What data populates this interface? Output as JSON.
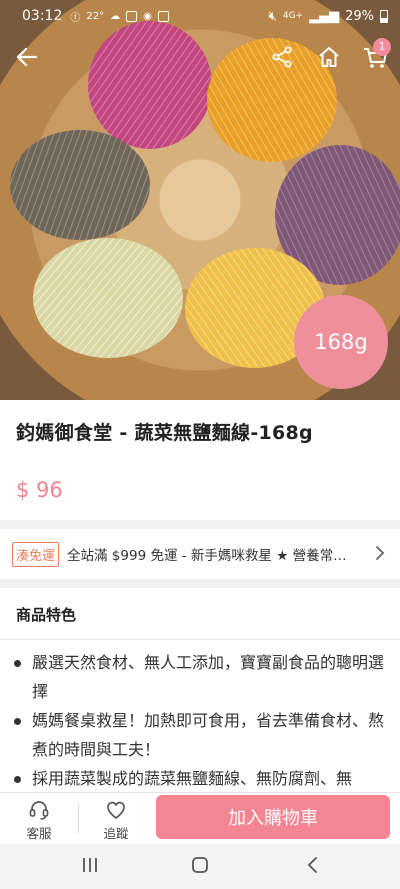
{
  "status_bar": {
    "time": "03:12",
    "temperature": "22°",
    "network": "4G+",
    "battery": "29%"
  },
  "top_nav": {
    "cart_count": "1"
  },
  "hero": {
    "weight_badge": "168g"
  },
  "product": {
    "title": "鈞媽御食堂 - 蔬菜無鹽麵線-168g",
    "price": "$ 96"
  },
  "promo": {
    "tag": "湊免運",
    "text": "全站滿 $999 免運 - 新手媽咪救星 ★ 營養常溫..."
  },
  "features": {
    "title": "商品特色",
    "items": [
      "嚴選天然食材、無人工添加，寶寶副食品的聰明選擇",
      "媽媽餐桌救星！加熱即可食用，省去準備食材、熬煮的時間與工夫！",
      "採用蔬菜製成的蔬菜無鹽麵線、無防腐劑、無"
    ]
  },
  "action_bar": {
    "service_label": "客服",
    "follow_label": "追蹤",
    "add_to_cart_label": "加入購物車"
  },
  "colors": {
    "accent_pink": "#f48593",
    "price_pink": "#f2848f",
    "promo_orange": "#e87d5a"
  }
}
